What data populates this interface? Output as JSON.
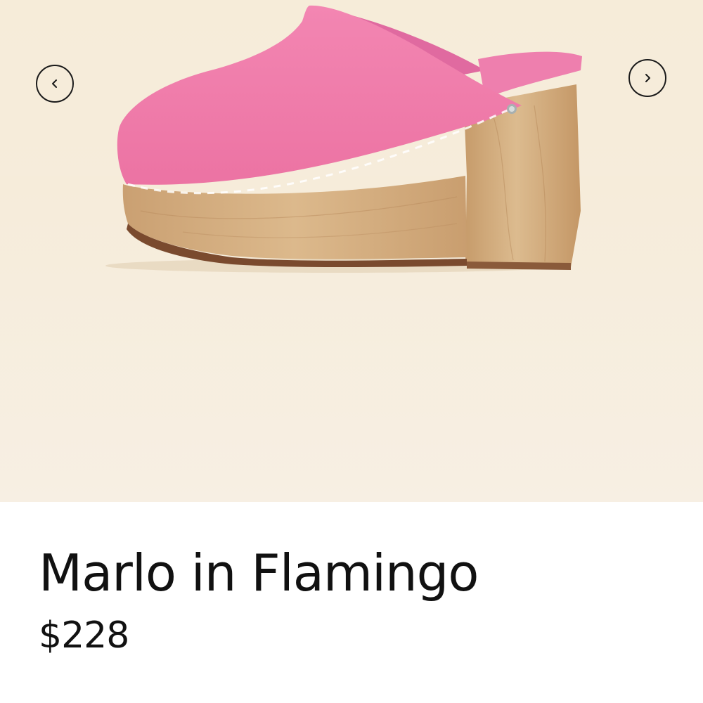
{
  "product": {
    "title": "Marlo in Flamingo",
    "price": "$228"
  },
  "gallery": {
    "prev_icon": "chevron-left-icon",
    "next_icon": "chevron-right-icon"
  },
  "colors": {
    "background": "#f6ecdb",
    "suede": "#f07aa8",
    "wood": "#d2ab7c",
    "text": "#111111"
  }
}
